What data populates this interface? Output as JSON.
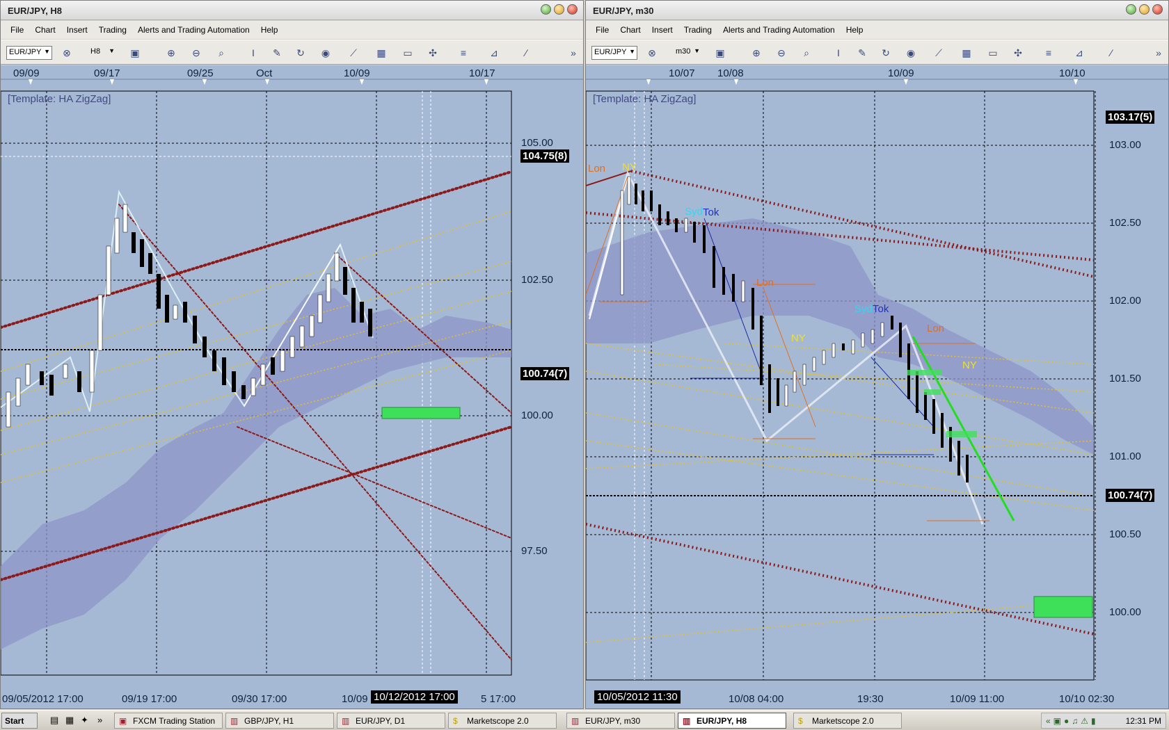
{
  "left": {
    "title": "EUR/JPY, H8",
    "menu": [
      "File",
      "Chart",
      "Insert",
      "Trading",
      "Alerts and Trading Automation",
      "Help"
    ],
    "symbol": "EUR/JPY",
    "timeframe": "H8",
    "template": "[Template: HA ZigZag]",
    "top_dates": [
      "09/09",
      "09/17",
      "09/25",
      "Oct",
      "10/09",
      "10/17"
    ],
    "bottom_dates": [
      "09/05/2012 17:00",
      "09/19 17:00",
      "09/30 17:00",
      "10/09",
      "5 17:00"
    ],
    "price_labels": [
      "105.00",
      "102.50",
      "100.00",
      "97.50"
    ],
    "current_price_box": "100.74(7)",
    "top_price_box": "104.75(8)",
    "cursor_time": "10/12/2012 17:00"
  },
  "right": {
    "title": "EUR/JPY, m30",
    "menu": [
      "File",
      "Chart",
      "Insert",
      "Trading",
      "Alerts and Trading Automation",
      "Help"
    ],
    "symbol": "EUR/JPY",
    "timeframe": "m30",
    "template": "[Template: HA ZigZag]",
    "top_dates": [
      "10/07",
      "10/08",
      "10/09",
      "10/10"
    ],
    "bottom_dates": [
      "10/08 04:00",
      "19:30",
      "10/09 11:00",
      "10/10 02:30"
    ],
    "price_labels": [
      "103.00",
      "102.50",
      "102.00",
      "101.50",
      "101.00",
      "100.50",
      "100.00"
    ],
    "current_price_box": "100.74(7)",
    "top_price_box": "103.17(5)",
    "cursor_time": "10/05/2012 11:30",
    "session_labels": [
      "Lon",
      "NY",
      "Syd",
      "Tok",
      "Lon",
      "NY",
      "Syd",
      "Tok",
      "Lon",
      "NY"
    ]
  },
  "taskbar": {
    "start": "Start",
    "tasks": [
      "FXCM Trading Station",
      "GBP/JPY, H1",
      "EUR/JPY, D1",
      "Marketscope 2.0",
      "EUR/JPY, m30",
      "EUR/JPY, H8",
      "Marketscope 2.0"
    ],
    "active_task": "EUR/JPY, H8",
    "clock": "12:31 PM"
  },
  "colors": {
    "chart_bg": "#a6b9d4",
    "channel": "#8b1a1a",
    "fib": "#e8c020",
    "cloud": "#8e95c8",
    "zigzag": "#dfe6f2",
    "green_zone": "#3ee05a"
  }
}
